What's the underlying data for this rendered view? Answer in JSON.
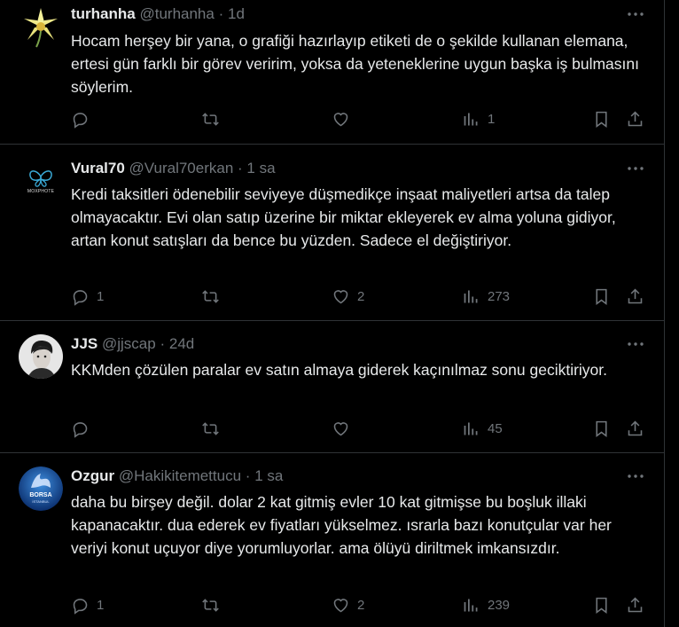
{
  "tweets": [
    {
      "name": "turhanha",
      "handle": "@turhanha",
      "time": "1d",
      "text": "Hocam herşey bir yana, o grafiği hazırlayıp etiketi de o şekilde kullanan elemana, ertesi gün farklı bir görev veririm, yoksa da yeteneklerine uygun başka iş bulmasını söylerim.",
      "replies": "",
      "retweets": "",
      "likes": "",
      "views": "1"
    },
    {
      "name": "Vural70",
      "handle": "@Vural70erkan",
      "time": "1 sa",
      "avatar_text": "MOXPHOTE",
      "text": "Kredi taksitleri ödenebilir seviyeye düşmedikçe inşaat maliyetleri artsa da talep olmayacaktır. Evi olan satıp üzerine bir miktar ekleyerek ev alma yoluna gidiyor, artan konut satışları da bence bu yüzden. Sadece el değiştiriyor.",
      "replies": "1",
      "retweets": "",
      "likes": "2",
      "views": "273"
    },
    {
      "name": "JJS",
      "handle": "@jjscap",
      "time": "24d",
      "text": "KKMden çözülen paralar ev satın almaya giderek kaçınılmaz sonu geciktiriyor.",
      "replies": "",
      "retweets": "",
      "likes": "",
      "views": "45"
    },
    {
      "name": "Ozgur",
      "handle": "@Hakikitemettucu",
      "time": "1 sa",
      "avatar_text": "BORSA",
      "avatar_sub": "İSTANBUL",
      "text": "daha bu birşey değil.  dolar  2 kat gitmiş evler 10 kat gitmişse bu  boşluk illaki kapanacaktır. dua ederek ev fiyatları yükselmez.  ısrarla bazı konutçular var her veriyi konut uçuyor diye yorumluyorlar. ama ölüyü diriltmek imkansızdır.",
      "replies": "1",
      "retweets": "",
      "likes": "2",
      "views": "239"
    }
  ],
  "separator": "·",
  "colors": {
    "background": "#000000",
    "text": "#e7e9ea",
    "muted": "#71767b",
    "border": "#2f3336"
  },
  "icons": [
    "reply-icon",
    "retweet-icon",
    "like-icon",
    "views-icon",
    "bookmark-icon",
    "share-icon",
    "more-icon"
  ]
}
